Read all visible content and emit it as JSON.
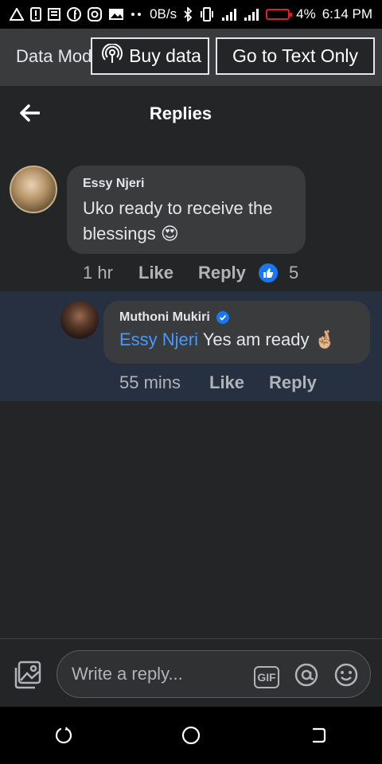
{
  "status_bar": {
    "speed": "0B/s",
    "battery": "4%",
    "time": "6:14 PM"
  },
  "data_banner": {
    "mode_label": "Data Mode",
    "buy_label": "Buy data",
    "text_only_label": "Go to Text Only"
  },
  "header": {
    "title": "Replies"
  },
  "comment": {
    "author": "Essy Njeri",
    "text": "Uko ready to receive the blessings 😍",
    "time": "1 hr",
    "like_label": "Like",
    "reply_label": "Reply",
    "reaction_count": "5"
  },
  "reply": {
    "author": "Muthoni  Mukiri",
    "mention": "Essy Njeri",
    "text": " Yes am ready 🤞🏼",
    "time": "55 mins",
    "like_label": "Like",
    "reply_label": "Reply"
  },
  "composer": {
    "placeholder": "Write a reply..."
  },
  "colors": {
    "background": "#242526",
    "bubble": "#3a3b3c",
    "highlight_row": "#263040",
    "mention": "#4599ff",
    "accent": "#1877f2"
  }
}
